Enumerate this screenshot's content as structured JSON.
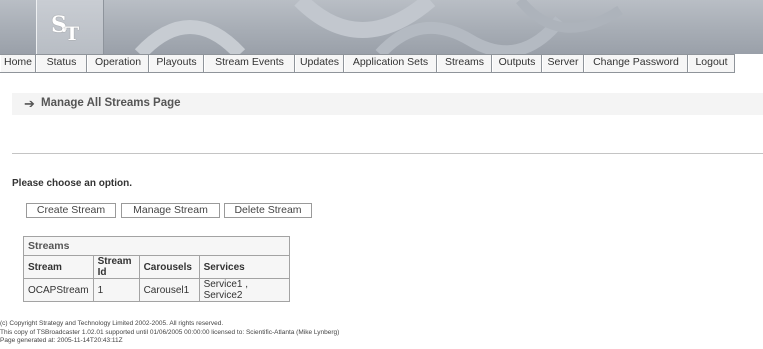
{
  "logo": {
    "letters": "ST"
  },
  "nav": [
    {
      "label": "Home"
    },
    {
      "label": "Status"
    },
    {
      "label": "Operation"
    },
    {
      "label": "Playouts"
    },
    {
      "label": "Stream Events"
    },
    {
      "label": "Updates"
    },
    {
      "label": "Application Sets"
    },
    {
      "label": "Streams"
    },
    {
      "label": "Outputs"
    },
    {
      "label": "Server"
    },
    {
      "label": "Change Password"
    },
    {
      "label": "Logout"
    }
  ],
  "page": {
    "title": "Manage All Streams Page",
    "prompt": "Please choose an option."
  },
  "buttons": {
    "create": "Create Stream",
    "manage": "Manage Stream",
    "delete": "Delete Stream"
  },
  "table": {
    "caption": "Streams",
    "headers": [
      "Stream",
      "Stream Id",
      "Carousels",
      "Services"
    ],
    "rows": [
      [
        "OCAPStream",
        "1",
        "Carousel1",
        "Service1 , Service2"
      ]
    ]
  },
  "footer": {
    "line1": "(c) Copyright Strategy and Technology Limited 2002-2005. All rights reserved.",
    "line2": "This copy of TSBroadcaster 1.02.01 supported until 01/06/2005 00:00:00 licensed to: Scientific-Atlanta (Mike Lynberg)",
    "line3": "Page generated at: 2005-11-14T20:43:11Z"
  }
}
